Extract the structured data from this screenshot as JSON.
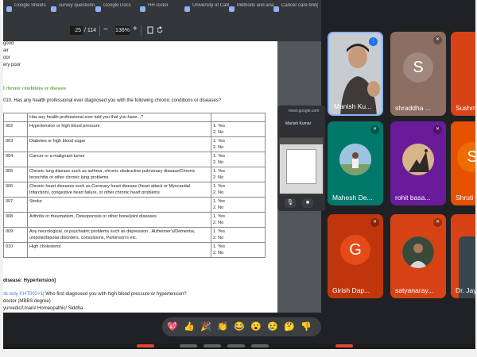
{
  "browser": {
    "tabs": [
      {
        "label": "Google Sheets"
      },
      {
        "label": "survey questionnaire"
      },
      {
        "label": "Google Docs"
      },
      {
        "label": "HH roster"
      },
      {
        "label": "University of California"
      },
      {
        "label": "Methods and analysis"
      },
      {
        "label": "Cancer care bridge"
      }
    ]
  },
  "pdf_toolbar": {
    "page_current": "25",
    "page_total": "/ 114",
    "zoom_minus": "−",
    "zoom": "136%",
    "zoom_plus": "+"
  },
  "document": {
    "top_options": [
      "good",
      "air",
      "oor",
      "ery poor"
    ],
    "section_heading": "l chronic conditions or diseases",
    "question_intro": "010. Has any health professional ever diagnosed you with the following chronic conditions or diseases?",
    "table_header": "Has any health professional ever told you that you have...?",
    "rows": [
      {
        "code": "002",
        "text": "Hypertension or high blood pressure",
        "opt1": "1.    Yes",
        "opt2": "2.    No"
      },
      {
        "code": "003",
        "text": "Diabetes or high blood sugar",
        "opt1": "1.    Yes",
        "opt2": "2.    No"
      },
      {
        "code": "004",
        "text": "Cancer or a malignant tumor",
        "opt1": "1.    Yes",
        "opt2": "2.    No"
      },
      {
        "code": "005",
        "text": "Chronic lung disease such as asthma ,chronic obstructive pulmonary disease/Chronic bronchitis or other chronic lung problems",
        "opt1": "1.    Yes",
        "opt2": "2.    No"
      },
      {
        "code": "006",
        "text": "Chronic heart diseases such as Coronary heart disease (heart attack or Myocardial Infarction), congestive heart failure, or other chronic heart problems",
        "opt1": "1.    Yes",
        "opt2": "2.    No"
      },
      {
        "code": "007",
        "text": "Stroke",
        "opt1": "1.    Yes",
        "opt2": "2.    No"
      },
      {
        "code": "008",
        "text": "Arthritis or rheumatism, Osteoporosis or other bone/joint diseases",
        "opt1": "1.    Yes",
        "opt2": "2.    No"
      },
      {
        "code": "009",
        "text": "Any neurological, or psychiatric problems such as depression , Alzheimer's/Dementia, unipolar/bipolar disorders, convulsions, Parkinson's etc.",
        "opt1": "1.    Yes",
        "opt2": "2.    No"
      },
      {
        "code": "010",
        "text": "High cholesterol",
        "opt1": "1.    Yes",
        "opt2": "2.    No"
      }
    ],
    "disease_heading": "disease: Hypertension]",
    "ask_note": "sk only if HT002=1]",
    "ask_question": "Who first diagnosed you with high blood pressure or hypertension?",
    "answer1": "doctor (MBBS degree)",
    "answer2": "yurvedic/Unani/ Homeopathic/ Siddha"
  },
  "pip": {
    "url": "meet.google.com",
    "presenter": "Manish Kumar"
  },
  "participants": [
    {
      "name": "Manish Ku...",
      "bg": "#3c4043"
    },
    {
      "name": "shraddha ...",
      "initial": "S",
      "bg": "#8d6e63",
      "avatar_bg": "#a1887f"
    },
    {
      "name": "Sushma",
      "bg": "#d84315"
    },
    {
      "name": "Mahesh De...",
      "bg": "#00796b"
    },
    {
      "name": "rohit basa...",
      "bg": "#6a1b9a"
    },
    {
      "name": "Shruti",
      "initial": "S",
      "bg": "#e65100",
      "avatar_bg": "#ef6c00"
    },
    {
      "name": "Girish Dap...",
      "initial": "G",
      "bg": "#bf360c",
      "avatar_bg": "#e64a19"
    },
    {
      "name": "satyanaray...",
      "bg": "#d84315"
    },
    {
      "name": "Dr. Jay",
      "bg": "#37474f"
    }
  ],
  "reactions": [
    "💖",
    "👍",
    "🎉",
    "👏",
    "😂",
    "😮",
    "😢",
    "🤔",
    "👎"
  ]
}
